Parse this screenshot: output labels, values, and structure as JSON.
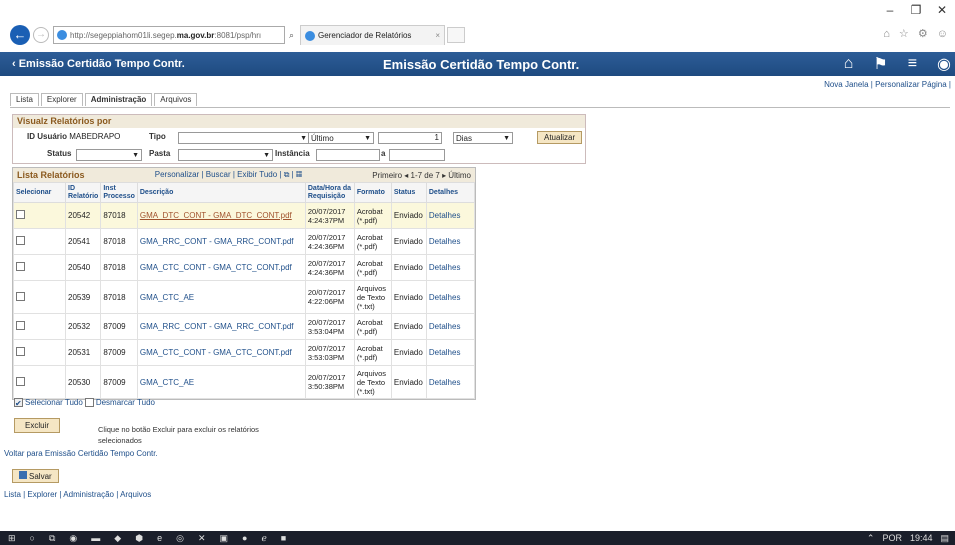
{
  "window": {
    "minimize": "–",
    "restore": "❐",
    "close": "✕"
  },
  "addressbar": {
    "url_prefix": "http://segeppiahom01li.segep.",
    "url_domain": "ma.gov.br",
    "url_suffix": ":8081/psp/hrı",
    "search_icon": "⌕",
    "tab_title": "Gerenciador de Relatórios",
    "tab_close": "×",
    "toolbar_icons": "⌂ ☆ ⚙ ☺"
  },
  "banner": {
    "back_label": "‹ Emissão Certidão Tempo Contr.",
    "title": "Emissão Certidão Tempo Contr.",
    "home_icon": "⌂",
    "flag_icon": "⚑",
    "menu_icon": "≡",
    "nav_icon": "◉"
  },
  "page_links": {
    "new_window": "Nova Janela",
    "sep": " | ",
    "personalize": "Personalizar Página",
    "sep2": " |"
  },
  "tabs": [
    "Lista",
    "Explorer",
    "Administração",
    "Arquivos"
  ],
  "filter": {
    "title": "Visualz Relatórios por",
    "id_label": "ID Usuário",
    "id_value": "MABEDRAPO",
    "tipo_label": "Tipo",
    "tipo_value": "",
    "last_value": "Último",
    "count_value": "1",
    "unit_value": "Dias",
    "refresh": "Atualizar",
    "status_label": "Status",
    "status_value": "",
    "folder_label": "Pasta",
    "folder_value": "",
    "instance_label": "Instância",
    "instance_from": "",
    "to_label": "a",
    "instance_to": ""
  },
  "list": {
    "title": "Lista Relatórios",
    "tools": "Personalizar | Buscar | Exibir Tudo | ⧉ | ▦",
    "nav": "Primeiro  ◂  1-7 de 7  ▸  Último",
    "columns": [
      "Selecionar",
      "ID Relatório",
      "Inst Processo",
      "Descrição",
      "Data/Hora da Requisição",
      "Formato",
      "Status",
      "Detalhes"
    ],
    "rows": [
      {
        "id": "20542",
        "inst": "87018",
        "desc": "GMA_DTC_CONT - GMA_DTC_CONT.pdf",
        "date": "20/07/2017 4:24:37PM",
        "fmt": "Acrobat (*.pdf)",
        "status": "Enviado",
        "det": "Detalhes"
      },
      {
        "id": "20541",
        "inst": "87018",
        "desc": "GMA_RRC_CONT - GMA_RRC_CONT.pdf",
        "date": "20/07/2017 4:24:36PM",
        "fmt": "Acrobat (*.pdf)",
        "status": "Enviado",
        "det": "Detalhes"
      },
      {
        "id": "20540",
        "inst": "87018",
        "desc": "GMA_CTC_CONT - GMA_CTC_CONT.pdf",
        "date": "20/07/2017 4:24:36PM",
        "fmt": "Acrobat (*.pdf)",
        "status": "Enviado",
        "det": "Detalhes"
      },
      {
        "id": "20539",
        "inst": "87018",
        "desc": "GMA_CTC_AE",
        "date": "20/07/2017 4:22:06PM",
        "fmt": "Arquivos de Texto (*.txt)",
        "status": "Enviado",
        "det": "Detalhes"
      },
      {
        "id": "20532",
        "inst": "87009",
        "desc": "GMA_RRC_CONT - GMA_RRC_CONT.pdf",
        "date": "20/07/2017 3:53:04PM",
        "fmt": "Acrobat (*.pdf)",
        "status": "Enviado",
        "det": "Detalhes"
      },
      {
        "id": "20531",
        "inst": "87009",
        "desc": "GMA_CTC_CONT - GMA_CTC_CONT.pdf",
        "date": "20/07/2017 3:53:03PM",
        "fmt": "Acrobat (*.pdf)",
        "status": "Enviado",
        "det": "Detalhes"
      },
      {
        "id": "20530",
        "inst": "87009",
        "desc": "GMA_CTC_AE",
        "date": "20/07/2017 3:50:38PM",
        "fmt": "Arquivos de Texto (*.txt)",
        "status": "Enviado",
        "det": "Detalhes"
      }
    ]
  },
  "select_all": "Selecionar Tudo",
  "deselect_all": "Desmarcar Tudo",
  "delete_btn": "Excluir",
  "delete_note": "Clique no botão Excluir para excluir os relatórios selecionados",
  "back_link": "Voltar para Emissão Certidão Tempo Contr.",
  "save_btn": "Salvar",
  "bottom_links": "Lista | Explorer | Administração | Arquivos",
  "taskbar": {
    "start": "⊞",
    "search": "○",
    "view": "⧉",
    "lang": "POR",
    "time": "19:44",
    "tray": "⌃",
    "notif": "▤",
    "apps": [
      "◉",
      "▬",
      "◆",
      "⬢",
      "e",
      "◎",
      "✕",
      "▣",
      "●",
      "ℯ",
      "■"
    ]
  }
}
